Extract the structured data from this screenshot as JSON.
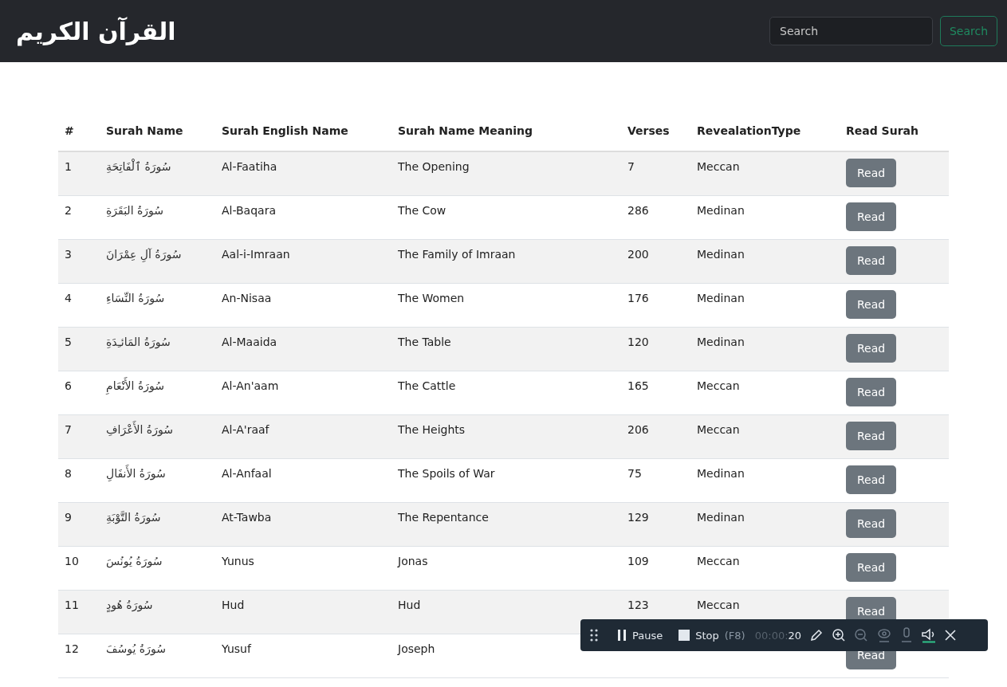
{
  "navbar": {
    "logo": "القرآن الكريم",
    "search": {
      "placeholder": "Search"
    },
    "search_button": "Search"
  },
  "table": {
    "columns": [
      "#",
      "Surah Name",
      "Surah English Name",
      "Surah Name Meaning",
      "Verses",
      "RevealationType",
      "Read Surah"
    ],
    "rows": [
      {
        "number": "1",
        "name": "سُورَةُ ٱلْفَاتِحَةِ",
        "english_name": "Al-Faatiha",
        "meaning": "The Opening",
        "verses": "7",
        "type": "Meccan",
        "button": "Read"
      },
      {
        "number": "2",
        "name": "سُورَةُ البَقَرَةِ",
        "english_name": "Al-Baqara",
        "meaning": "The Cow",
        "verses": "286",
        "type": "Medinan",
        "button": "Read"
      },
      {
        "number": "3",
        "name": "سُورَةُ آلِ عِمْرَانَ",
        "english_name": "Aal-i-Imraan",
        "meaning": "The Family of Imraan",
        "verses": "200",
        "type": "Medinan",
        "button": "Read"
      },
      {
        "number": "4",
        "name": "سُورَةُ النِّسَاءِ",
        "english_name": "An-Nisaa",
        "meaning": "The Women",
        "verses": "176",
        "type": "Medinan",
        "button": "Read"
      },
      {
        "number": "5",
        "name": "سُورَةُ المَائـِدَةِ",
        "english_name": "Al-Maaida",
        "meaning": "The Table",
        "verses": "120",
        "type": "Medinan",
        "button": "Read"
      },
      {
        "number": "6",
        "name": "سُورَةُ الأَنْعَامِ",
        "english_name": "Al-An'aam",
        "meaning": "The Cattle",
        "verses": "165",
        "type": "Meccan",
        "button": "Read"
      },
      {
        "number": "7",
        "name": "سُورَةُ الأَعْرَافِ",
        "english_name": "Al-A'raaf",
        "meaning": "The Heights",
        "verses": "206",
        "type": "Meccan",
        "button": "Read"
      },
      {
        "number": "8",
        "name": "سُورَةُ الأَنفَالِ",
        "english_name": "Al-Anfaal",
        "meaning": "The Spoils of War",
        "verses": "75",
        "type": "Medinan",
        "button": "Read"
      },
      {
        "number": "9",
        "name": "سُورَةُ التَّوْبَةِ",
        "english_name": "At-Tawba",
        "meaning": "The Repentance",
        "verses": "129",
        "type": "Medinan",
        "button": "Read"
      },
      {
        "number": "10",
        "name": "سُورَةُ يُونُسَ",
        "english_name": "Yunus",
        "meaning": "Jonas",
        "verses": "109",
        "type": "Meccan",
        "button": "Read"
      },
      {
        "number": "11",
        "name": "سُورَةُ هُودٍ",
        "english_name": "Hud",
        "meaning": "Hud",
        "verses": "123",
        "type": "Meccan",
        "button": "Read"
      },
      {
        "number": "12",
        "name": "سُورَةُ يُوسُفَ",
        "english_name": "Yusuf",
        "meaning": "Joseph",
        "button": "Read"
      }
    ]
  },
  "recorder": {
    "pause": "Pause",
    "stop": "Stop",
    "stop_key": "(F8)",
    "time_dim": "00:00:",
    "time": "20"
  }
}
